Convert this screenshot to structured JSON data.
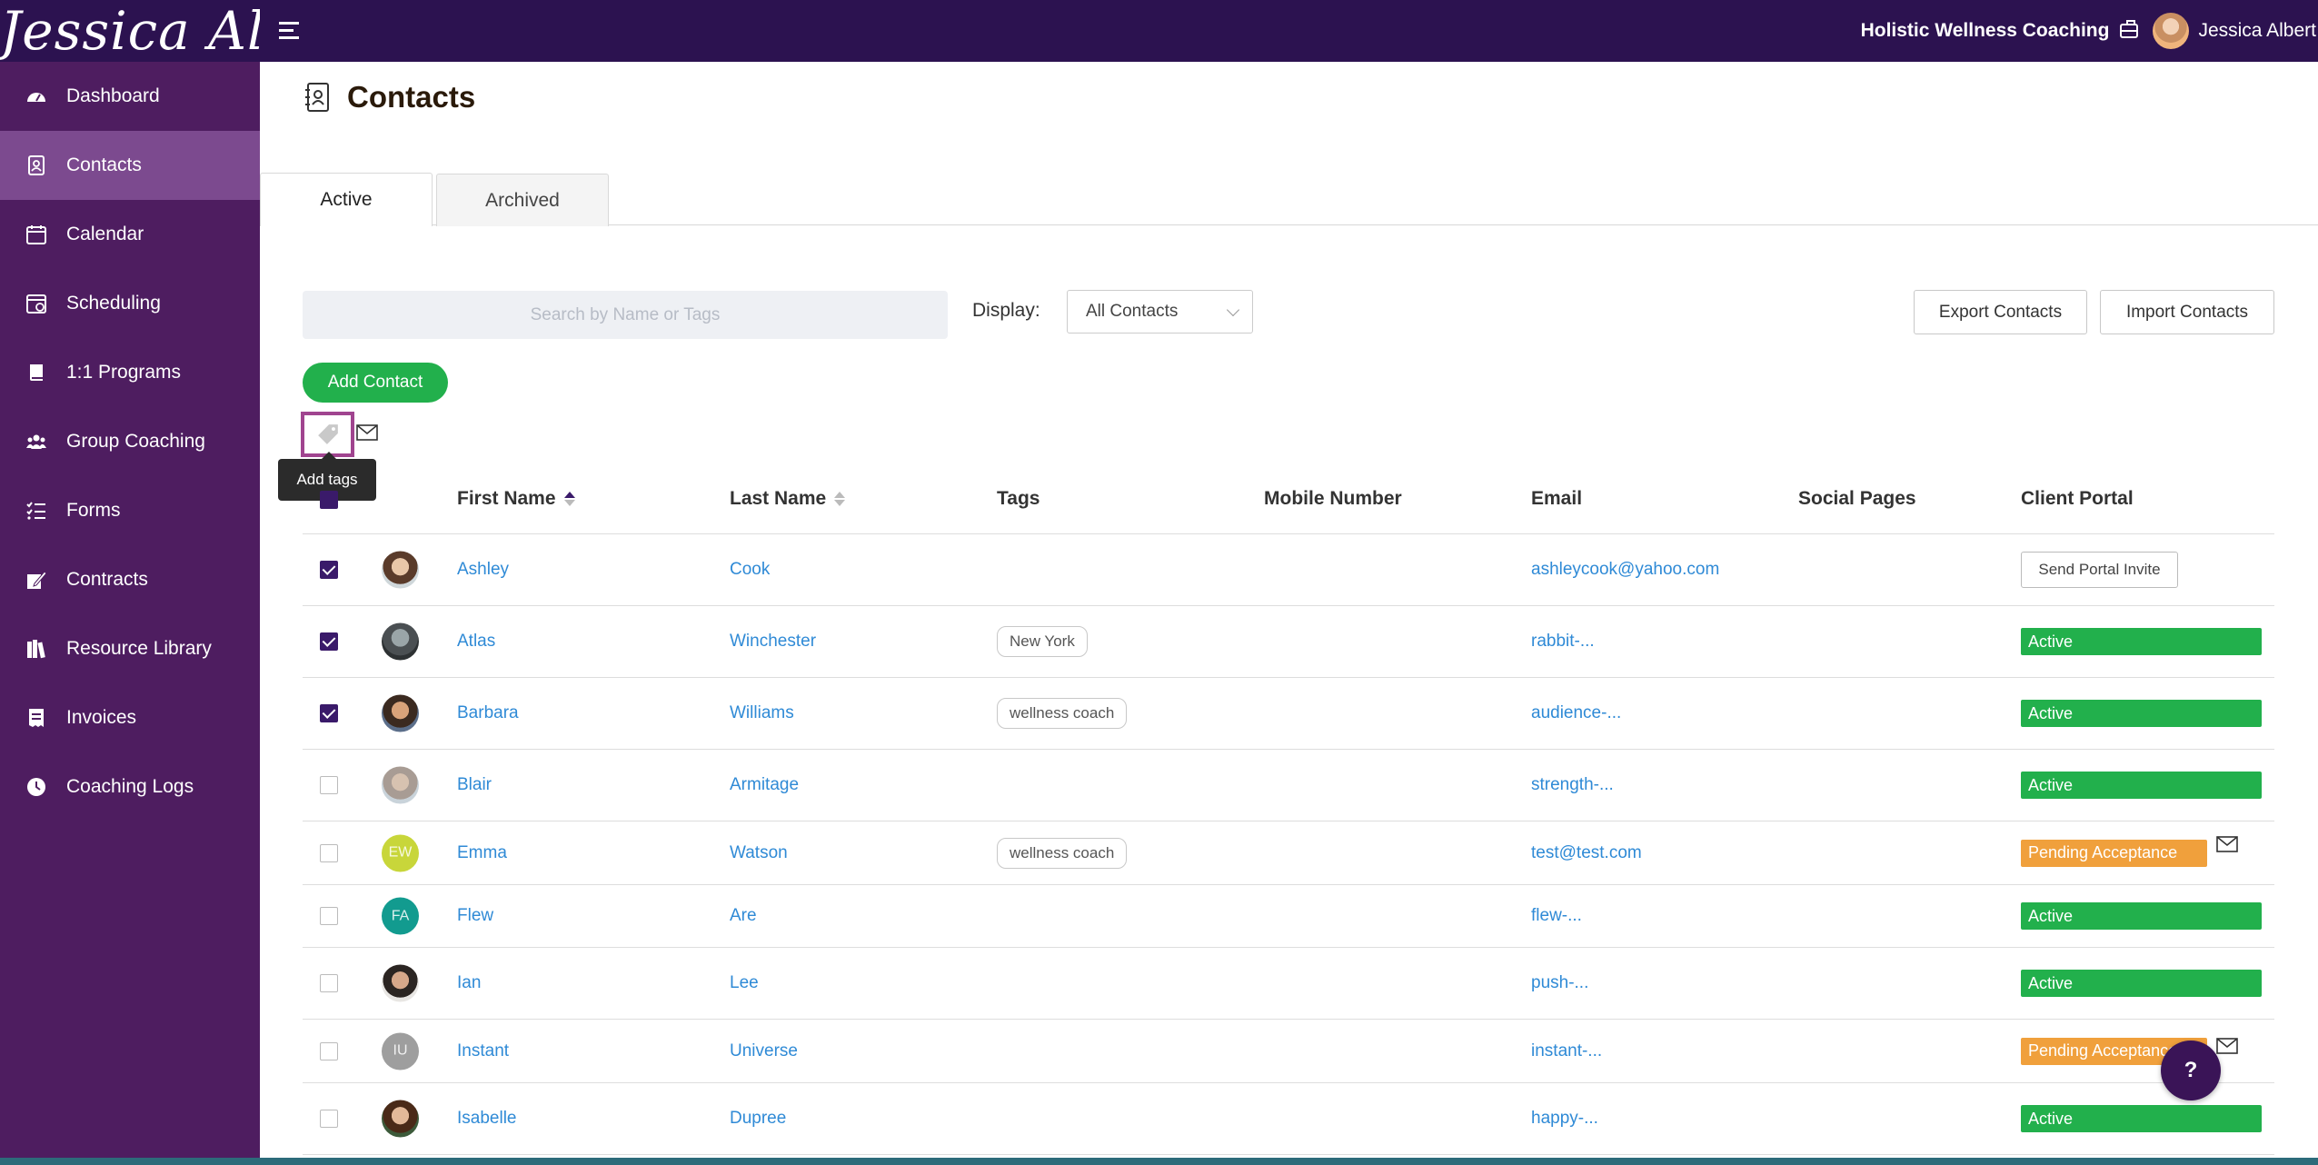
{
  "brand": {
    "logo_text": "Jessica Albert"
  },
  "topbar": {
    "business_name": "Holistic Wellness Coaching",
    "user_name": "Jessica Albert"
  },
  "sidebar": {
    "items": [
      {
        "label": "Dashboard",
        "icon": "dashboard-icon"
      },
      {
        "label": "Contacts",
        "icon": "contacts-icon",
        "active": true
      },
      {
        "label": "Calendar",
        "icon": "calendar-icon"
      },
      {
        "label": "Scheduling",
        "icon": "scheduling-icon"
      },
      {
        "label": "1:1 Programs",
        "icon": "book-icon"
      },
      {
        "label": "Group Coaching",
        "icon": "group-icon"
      },
      {
        "label": "Forms",
        "icon": "checklist-icon"
      },
      {
        "label": "Contracts",
        "icon": "contract-icon"
      },
      {
        "label": "Resource Library",
        "icon": "library-icon"
      },
      {
        "label": "Invoices",
        "icon": "invoice-icon"
      },
      {
        "label": "Coaching Logs",
        "icon": "clock-icon"
      }
    ]
  },
  "page": {
    "title": "Contacts"
  },
  "tabs": [
    {
      "label": "Active",
      "active": true
    },
    {
      "label": "Archived"
    }
  ],
  "toolbar": {
    "search_placeholder": "Search by Name or Tags",
    "display_label": "Display:",
    "display_value": "All Contacts",
    "export_label": "Export Contacts",
    "import_label": "Import Contacts",
    "add_contact_label": "Add Contact",
    "tooltip": "Add tags"
  },
  "table": {
    "headers": {
      "first_name": "First Name",
      "last_name": "Last Name",
      "tags": "Tags",
      "mobile": "Mobile Number",
      "email": "Email",
      "social": "Social Pages",
      "portal": "Client Portal"
    },
    "sort": {
      "column": "First Name",
      "direction": "ascending"
    },
    "rows": [
      {
        "checked": true,
        "avatar": "photo",
        "first": "Ashley",
        "last": "Cook",
        "tag": "",
        "email": "ashleycook@yahoo.com",
        "portal": "Send Portal Invite",
        "portal_type": "button"
      },
      {
        "checked": true,
        "avatar": "photo",
        "first": "Atlas",
        "last": "Winchester",
        "tag": "New York",
        "email": "rabbit-...",
        "portal": "Active",
        "portal_type": "active"
      },
      {
        "checked": true,
        "avatar": "photo",
        "first": "Barbara",
        "last": "Williams",
        "tag": "wellness coach",
        "email": "audience-...",
        "portal": "Active",
        "portal_type": "active"
      },
      {
        "checked": false,
        "avatar": "photo",
        "first": "Blair",
        "last": "Armitage",
        "tag": "",
        "email": "strength-...",
        "portal": "Active",
        "portal_type": "active"
      },
      {
        "checked": false,
        "avatar": "initials",
        "initials": "EW",
        "first": "Emma",
        "last": "Watson",
        "tag": "wellness coach",
        "email": "test@test.com",
        "portal": "Pending Acceptance",
        "portal_type": "pending"
      },
      {
        "checked": false,
        "avatar": "initials",
        "initials": "FA",
        "first": "Flew",
        "last": "Are",
        "tag": "",
        "email": "flew-...",
        "portal": "Active",
        "portal_type": "active"
      },
      {
        "checked": false,
        "avatar": "photo",
        "first": "Ian",
        "last": "Lee",
        "tag": "",
        "email": "push-...",
        "portal": "Active",
        "portal_type": "active"
      },
      {
        "checked": false,
        "avatar": "initials",
        "initials": "IU",
        "first": "Instant",
        "last": "Universe",
        "tag": "",
        "email": "instant-...",
        "portal": "Pending Acceptance",
        "portal_type": "pending"
      },
      {
        "checked": false,
        "avatar": "photo",
        "first": "Isabelle",
        "last": "Dupree",
        "tag": "",
        "email": "happy-...",
        "portal": "Active",
        "portal_type": "active"
      }
    ]
  },
  "help": {
    "label": "?"
  },
  "colors": {
    "topbar": "#2c1250",
    "sidebar": "#4e1d60",
    "accent": "#22b04c",
    "pending": "#f0a03c",
    "link": "#2f8ad6"
  }
}
